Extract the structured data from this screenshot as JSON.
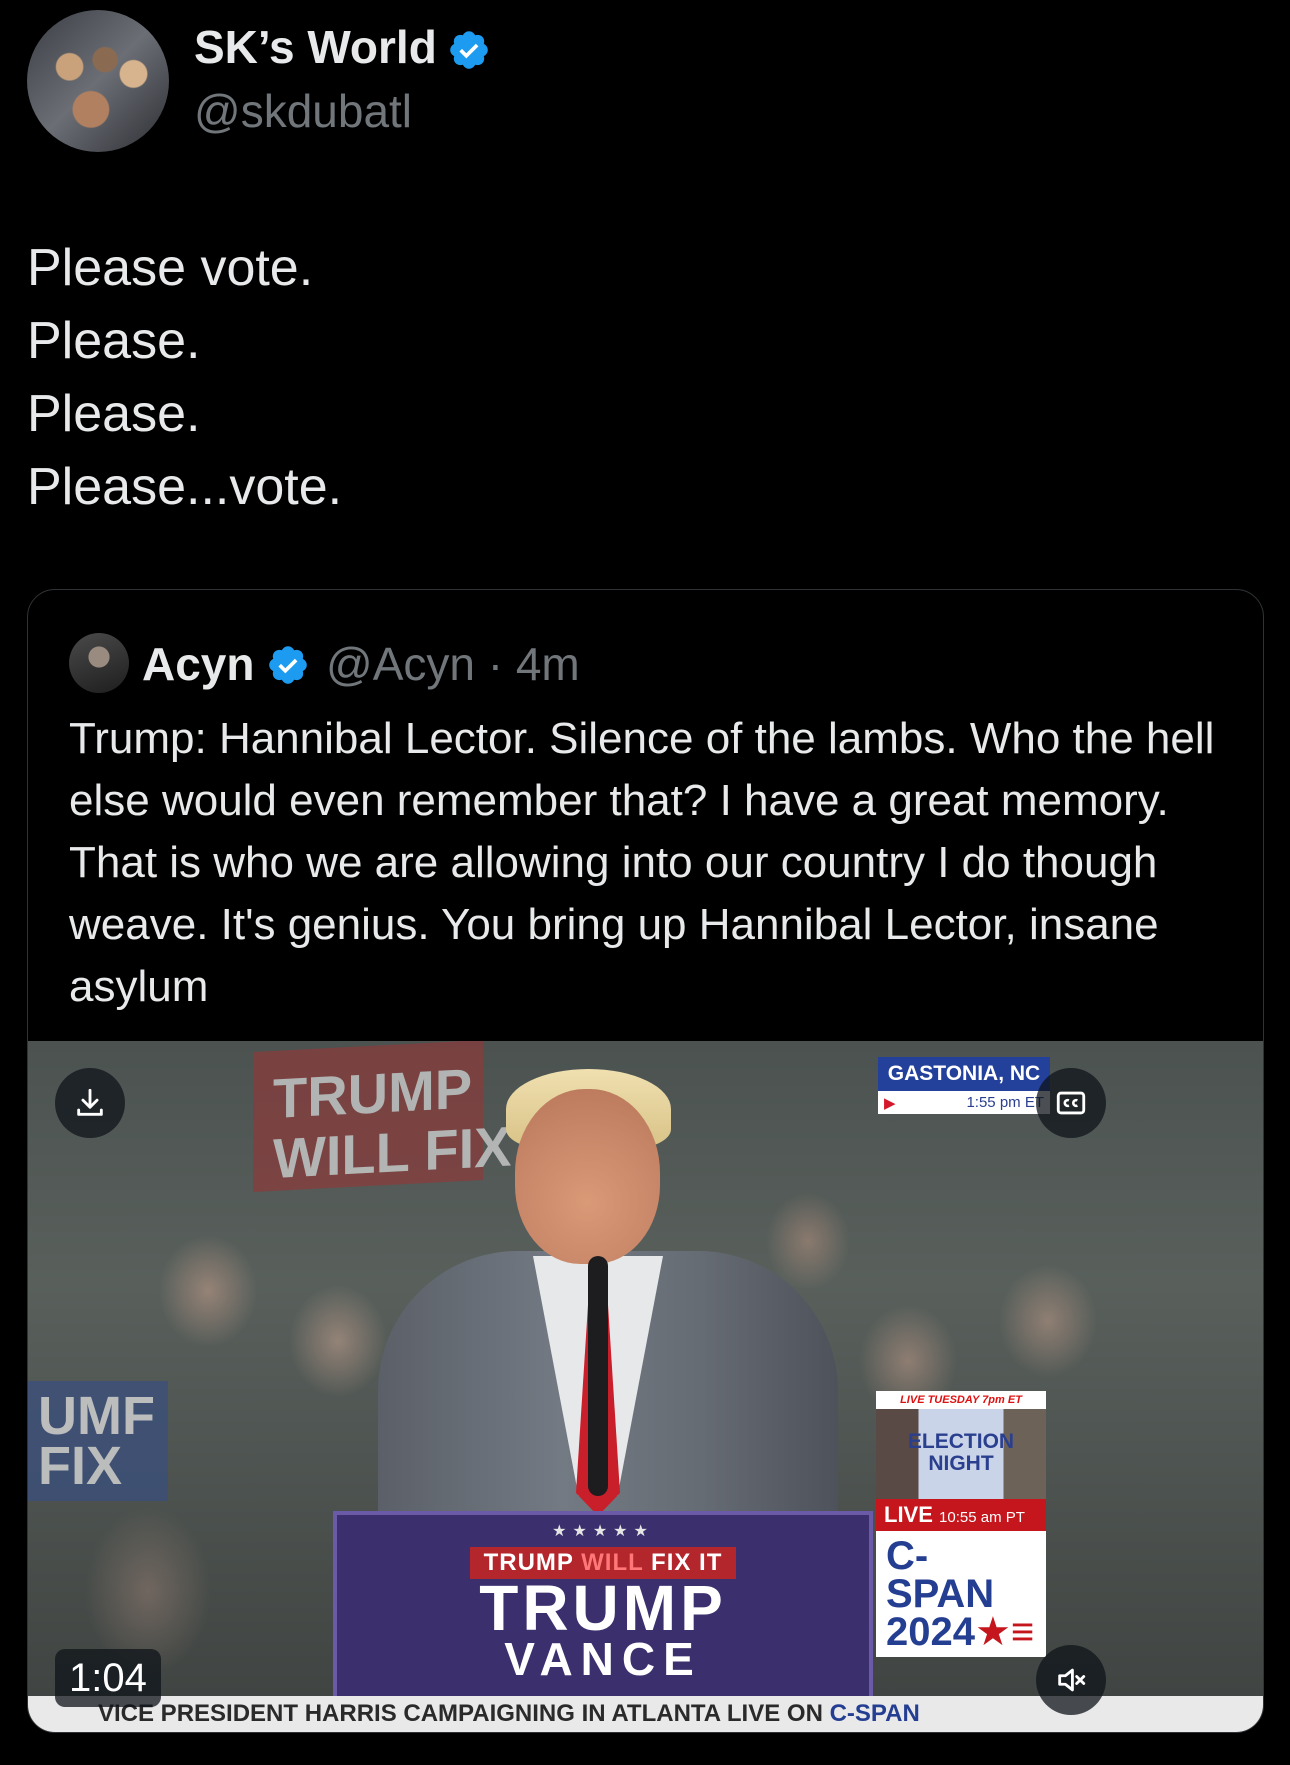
{
  "author": {
    "name": "SK’s World",
    "handle": "@skdubatl",
    "verified_color": "#1d9bf0"
  },
  "tweet": {
    "lines": [
      "Please vote.",
      "Please.",
      "Please.",
      "Please...vote."
    ]
  },
  "quote": {
    "name": "Acyn",
    "meta": "@Acyn · 4m",
    "text": "Trump: Hannibal Lector. Silence of the lambs. Who the hell else would even remember that? I have a great memory. That is who we are allowing into our country I do though weave. It's genius. You bring up Hannibal Lector, insane asylum"
  },
  "video": {
    "duration": "1:04",
    "sign_top": "TRUMP\nWILL FIX I",
    "sign_left": "UMF\nFIX",
    "podium_stars": "★★★★★",
    "podium_small_1": "TRUMP",
    "podium_small_2": "WILL",
    "podium_small_3": "FIX IT",
    "podium_big_1": "TRUMP",
    "podium_big_2": "VANCE",
    "location": "GASTONIA, NC",
    "time": "1:55 pm ET",
    "promo_top": "LIVE TUESDAY 7pm ET",
    "promo_title": "ELECTION NIGHT",
    "promo_live": "LIVE",
    "promo_live_time": "10:55 am PT",
    "promo_brand": "C-SPAN",
    "promo_year": "2024",
    "ticker_text": "VICE PRESIDENT HARRIS CAMPAIGNING IN ATLANTA LIVE ON",
    "ticker_brand": "C-SPAN"
  },
  "icons": {
    "download": "download-icon",
    "captions": "captions-icon",
    "mute": "volume-muted-icon",
    "verified": "verified-badge-icon"
  }
}
